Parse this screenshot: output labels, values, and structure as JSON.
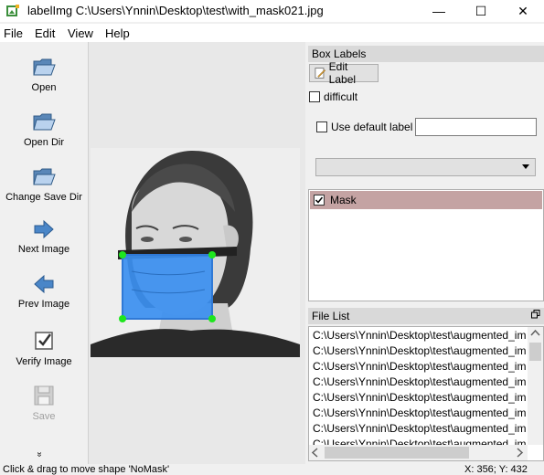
{
  "window": {
    "title": "labelImg C:\\Users\\Ynnin\\Desktop\\test\\with_mask021.jpg",
    "minimize": "—",
    "maximize": "☐",
    "close": "✕"
  },
  "menu": [
    "File",
    "Edit",
    "View",
    "Help"
  ],
  "toolbar": {
    "open": "Open",
    "open_dir": "Open Dir",
    "change_save_dir": "Change Save Dir",
    "next_image": "Next Image",
    "prev_image": "Prev Image",
    "verify_image": "Verify Image",
    "save": "Save",
    "more": "»"
  },
  "box_labels": {
    "title": "Box Labels",
    "edit_label": "Edit Label",
    "difficult": "difficult",
    "use_default_label": "Use default label",
    "default_label_value": "",
    "labels": [
      {
        "name": "Mask",
        "checked": true
      }
    ]
  },
  "file_list": {
    "title": "File List",
    "items": [
      "C:\\Users\\Ynnin\\Desktop\\test\\augmented_im",
      "C:\\Users\\Ynnin\\Desktop\\test\\augmented_im",
      "C:\\Users\\Ynnin\\Desktop\\test\\augmented_im",
      "C:\\Users\\Ynnin\\Desktop\\test\\augmented_im",
      "C:\\Users\\Ynnin\\Desktop\\test\\augmented_im",
      "C:\\Users\\Ynnin\\Desktop\\test\\augmented_im",
      "C:\\Users\\Ynnin\\Desktop\\test\\augmented_im",
      "C:\\Users\\Ynnin\\Desktop\\test\\augmented_im"
    ]
  },
  "status": {
    "message": "Click & drag to move shape 'NoMask'",
    "coords": "X: 356; Y: 432"
  },
  "colors": {
    "box_fill": "#3b8ff0",
    "handle": "#1ee61e",
    "label_highlight": "#c4a3a3"
  }
}
